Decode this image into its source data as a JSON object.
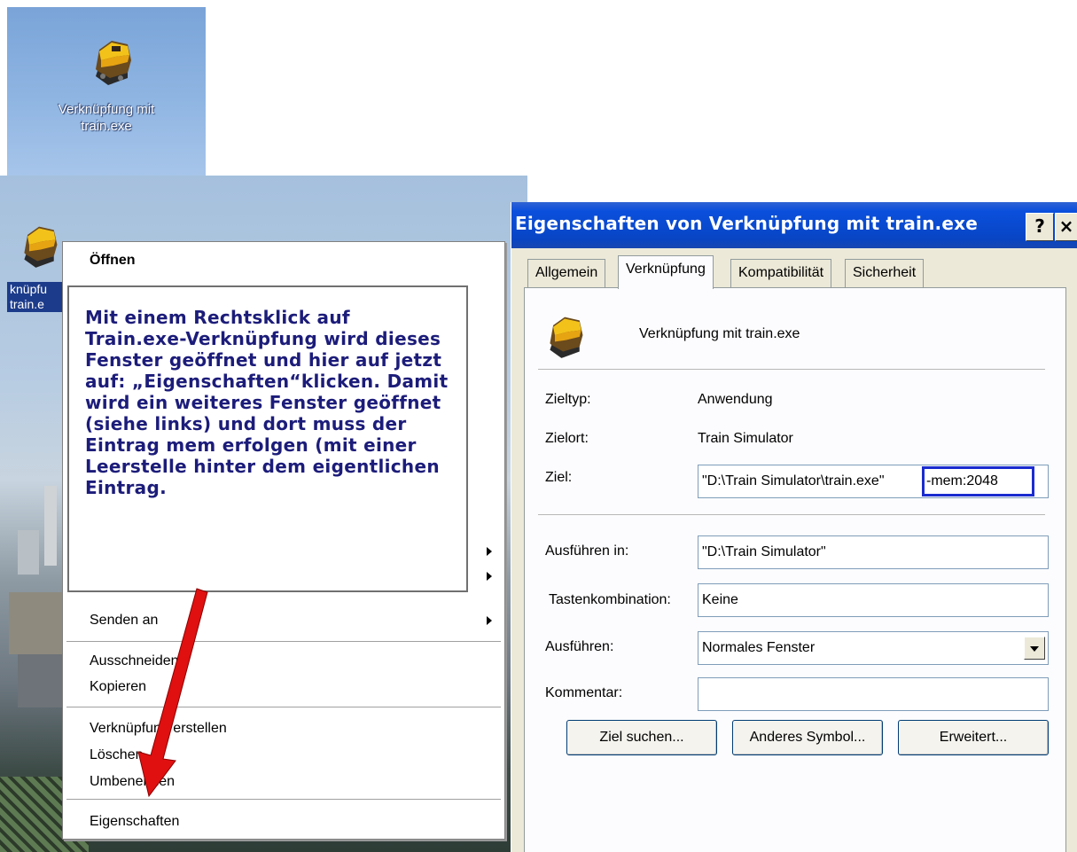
{
  "top_icon": {
    "label": "Verknüpfung mit\ntrain.exe",
    "icon": "train-locomotive-icon"
  },
  "desktop_icon": {
    "label": "knüpfu\ntrain.e",
    "icon": "train-locomotive-icon"
  },
  "context_menu": {
    "items": [
      {
        "label": "Öffnen",
        "bold": true
      },
      {
        "label": "Senden an",
        "submenu": true
      },
      {
        "label": "Ausschneiden"
      },
      {
        "label": "Kopieren"
      },
      {
        "label": "Verknüpfung erstellen"
      },
      {
        "label": "Löschen"
      },
      {
        "label": "Umbenennen"
      },
      {
        "label": "Eigenschaften"
      }
    ]
  },
  "annotation": {
    "text": "Mit einem Rechtsklick auf Train.exe-Verknüpfung wird dieses Fenster geöffnet und hier auf jetzt auf: „Eigenschaften“klicken. Damit wird ein weiteres Fenster geöffnet (siehe links) und dort muss der Eintrag mem erfolgen (mit einer Leerstelle hinter dem eigentlichen Eintrag.",
    "color": "#1c1c7a",
    "arrow_color": "#e01010"
  },
  "dialog": {
    "title": "Eigenschaften von Verknüpfung mit train.exe",
    "help_button": "?",
    "close_button": "×",
    "tabs": [
      "Allgemein",
      "Verknüpfung",
      "Kompatibilität",
      "Sicherheit"
    ],
    "active_tab": "Verknüpfung",
    "shortcut_name": "Verknüpfung mit train.exe",
    "fields": {
      "zieltyp_label": "Zieltyp:",
      "zieltyp_value": "Anwendung",
      "zielort_label": "Zielort:",
      "zielort_value": "Train Simulator",
      "ziel_label": "Ziel:",
      "ziel_value": "\"D:\\Train Simulator\\train.exe\"",
      "ziel_param": "-mem:2048",
      "ausfuehren_in_label": "Ausführen in:",
      "ausfuehren_in_value": "\"D:\\Train Simulator\"",
      "tastenkombination_label": "Tastenkombination:",
      "tastenkombination_value": "Keine",
      "ausfuehren_label": "Ausführen:",
      "ausfuehren_value": "Normales Fenster",
      "kommentar_label": "Kommentar:",
      "kommentar_value": ""
    },
    "buttons": {
      "ziel_suchen": "Ziel suchen...",
      "anderes_symbol": "Anderes Symbol...",
      "erweitert": "Erweitert..."
    },
    "highlight_color": "#1a2ccf",
    "titlebar_color": "#0a4fdc"
  }
}
